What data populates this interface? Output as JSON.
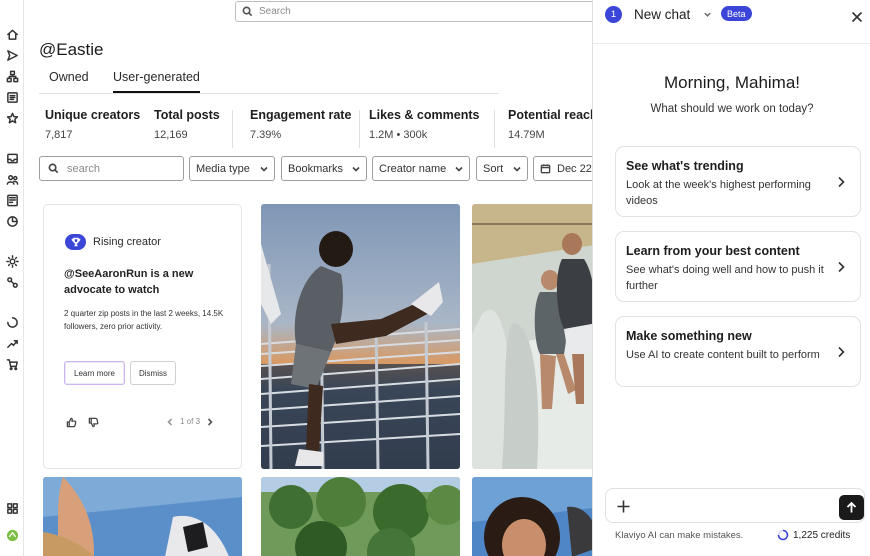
{
  "search": {
    "placeholder": "Search"
  },
  "brand": {
    "title": "@Eastie"
  },
  "tabs": [
    {
      "label": "Owned",
      "active": false
    },
    {
      "label": "User-generated",
      "active": true
    }
  ],
  "stats": [
    {
      "label": "Unique creators",
      "value": "7,817"
    },
    {
      "label": "Total posts",
      "value": "12,169"
    },
    {
      "label": "Engagement rate",
      "value": "7.39%"
    },
    {
      "label": "Likes & comments",
      "value": "1.2M • 300k"
    },
    {
      "label": "Potential reach",
      "value": "14.79M"
    }
  ],
  "filters": {
    "search_placeholder": "search",
    "media_type": "Media type",
    "bookmarks": "Bookmarks",
    "creator_name": "Creator name",
    "sort": "Sort",
    "date": "Dec 22"
  },
  "rising": {
    "label": "Rising creator",
    "title": "@SeeAaronRun is a new advocate to watch",
    "description": "2 quarter zip posts in the last 2 weeks, 14.5K followers, zero prior activity.",
    "learn_more": "Learn more",
    "dismiss": "Dismiss",
    "pager": "1 of 3"
  },
  "chat": {
    "number": "1",
    "title": "New chat",
    "badge": "Beta",
    "greeting": "Morning, Mahima!",
    "subgreeting": "What should we work on today?",
    "suggestions": [
      {
        "title": "See what's trending",
        "desc": "Look at the week's highest performing videos"
      },
      {
        "title": "Learn from your best content",
        "desc": "See what's doing well and how to push it further"
      },
      {
        "title": "Make something new",
        "desc": "Use AI to create content built to perform"
      }
    ],
    "disclaimer": "Klaviyo AI can make mistakes.",
    "credits": "1,225 credits"
  },
  "colors": {
    "accent": "#3b46d9",
    "send": "#1a1a1a"
  }
}
